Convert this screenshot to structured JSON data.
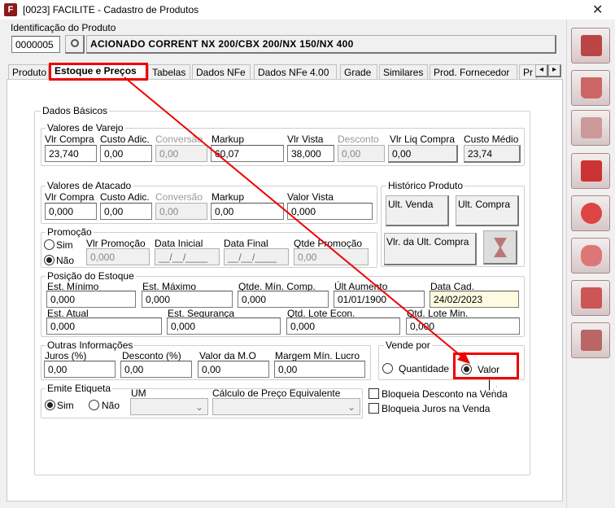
{
  "window": {
    "title": "[0023] FACILITE - Cadastro de Produtos",
    "icon_letter": "F",
    "close": "✕"
  },
  "ident": {
    "label": "Identificação do Produto",
    "code": "0000005",
    "description": "ACIONADO CORRENT NX 200/CBX 200/NX 150/NX 400"
  },
  "tabs": [
    "Produto",
    "Estoque e Preços",
    "Tabelas",
    "Dados NFe",
    "Dados NFe 4.00",
    "Grade",
    "Similares",
    "Prod. Fornecedor",
    "Pr"
  ],
  "tab_arrows": [
    "◂",
    "▸"
  ],
  "basic": {
    "title": "Dados Básicos"
  },
  "varejo": {
    "title": "Valores de Varejo",
    "labels": [
      "Vlr Compra",
      "Custo Adic.",
      "Conversão",
      "Markup",
      "Vlr Vista",
      "Desconto",
      "Vlr Liq Compra",
      "Custo Médio"
    ],
    "values": [
      "23,740",
      "0,00",
      "0,00",
      "60,07",
      "38,000",
      "0,00",
      "0,00",
      "23,74"
    ]
  },
  "atacado": {
    "title": "Valores de Atacado",
    "labels": [
      "Vlr Compra",
      "Custo Adic.",
      "Conversão",
      "Markup",
      "Valor Vista"
    ],
    "values": [
      "0,000",
      "0,00",
      "0,00",
      "0,00",
      "0,000"
    ]
  },
  "historico": {
    "title": "Histórico Produto",
    "ult_venda": "Ult. Venda",
    "ult_compra": "Ult. Compra",
    "vlr_ult_compra": "Vlr. da Ult. Compra"
  },
  "promocao": {
    "title": "Promoção",
    "sim": "Sim",
    "nao": "Não",
    "labels": [
      "Vlr Promoção",
      "Data Inicial",
      "Data Final",
      "Qtde Promoção"
    ],
    "values": [
      "0,000",
      "__/__/____",
      "__/__/____",
      "0,00"
    ]
  },
  "estoque": {
    "title": "Posição do Estoque",
    "labels": [
      "Est. Mínimo",
      "Est. Máximo",
      "Qtde. Mín. Comp.",
      "Últ Aumento",
      "Data Cad.",
      "Est. Atual",
      "Est. Segurança",
      "Qtd. Lote Econ.",
      "Qtd. Lote Min."
    ],
    "values": [
      "0,000",
      "0,000",
      "0,000",
      "01/01/1900",
      "24/02/2023",
      "0,000",
      "0,000",
      "0,000",
      "0,000"
    ]
  },
  "outras": {
    "title": "Outras Informações",
    "labels": [
      "Juros (%)",
      "Desconto (%)",
      "Valor da M.O",
      "Margem Mín. Lucro"
    ],
    "values": [
      "0,00",
      "0,00",
      "0,00",
      "0,00"
    ]
  },
  "vende": {
    "title": "Vende por",
    "quantidade": "Quantidade",
    "valor": "Valor"
  },
  "etiqueta": {
    "title": "Emite Etiqueta",
    "sim": "Sim",
    "nao": "Não",
    "um": "UM",
    "calculo": "Cálculo de Preço Equivalente"
  },
  "checks": {
    "bloq_desc": "Bloqueia Desconto na Venda",
    "bloq_juros": "Bloqueia Juros na Venda"
  },
  "colors": {
    "highlight": "#e00000",
    "accent": "#8b1a1a"
  }
}
